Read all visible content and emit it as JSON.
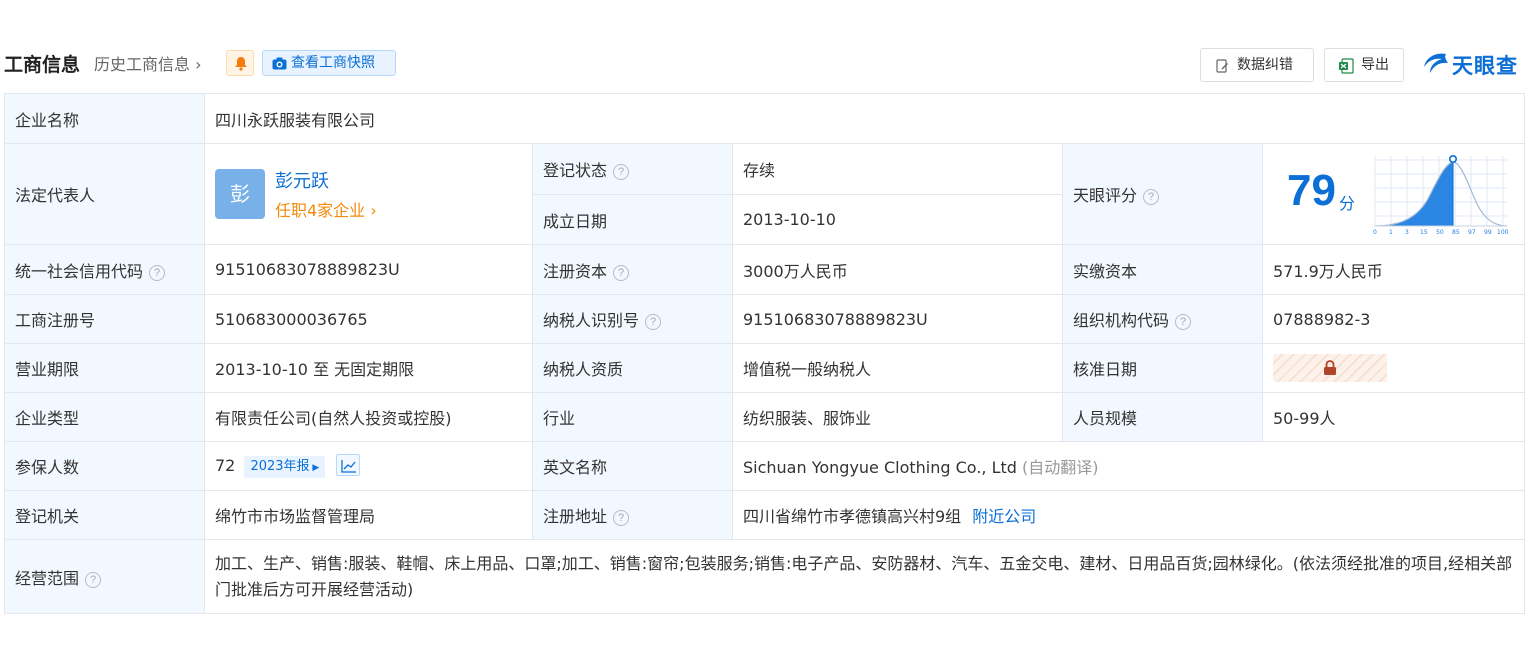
{
  "header": {
    "title": "工商信息",
    "history_link": "历史工商信息",
    "snapshot_button": "查看工商快照",
    "fix_button": "数据纠错",
    "export_button": "导出",
    "logo_text": "天眼查"
  },
  "company": {
    "name_label": "企业名称",
    "name": "四川永跃服装有限公司",
    "legal_rep_label": "法定代表人",
    "legal_rep_avatar": "彭",
    "legal_rep_name": "彭元跃",
    "legal_rep_roles": "任职4家企业",
    "reg_status_label": "登记状态",
    "reg_status": "存续",
    "found_date_label": "成立日期",
    "found_date": "2013-10-10",
    "score_label": "天眼评分",
    "score": "79",
    "score_unit": "分",
    "score_axis_labels": [
      "0",
      "1",
      "3",
      "15",
      "50",
      "85",
      "97",
      "99",
      "100"
    ],
    "credit_code_label": "统一社会信用代码",
    "credit_code": "91510683078889823U",
    "reg_capital_label": "注册资本",
    "reg_capital": "3000万人民币",
    "paid_capital_label": "实缴资本",
    "paid_capital": "571.9万人民币",
    "biz_reg_no_label": "工商注册号",
    "biz_reg_no": "510683000036765",
    "taxpayer_id_label": "纳税人识别号",
    "taxpayer_id": "91510683078889823U",
    "org_code_label": "组织机构代码",
    "org_code": "07888982-3",
    "term_label": "营业期限",
    "term": "2013-10-10 至 无固定期限",
    "taxpayer_qual_label": "纳税人资质",
    "taxpayer_qual": "增值税一般纳税人",
    "approval_date_label": "核准日期",
    "type_label": "企业类型",
    "type": "有限责任公司(自然人投资或控股)",
    "industry_label": "行业",
    "industry": "纺织服装、服饰业",
    "staff_size_label": "人员规模",
    "staff_size": "50-99人",
    "insured_label": "参保人数",
    "insured": "72",
    "insured_year_tag": "2023年报",
    "english_name_label": "英文名称",
    "english_name": "Sichuan Yongyue Clothing Co., Ltd",
    "english_name_note": "(自动翻译)",
    "authority_label": "登记机关",
    "authority": "绵竹市市场监督管理局",
    "address_label": "注册地址",
    "address": "四川省绵竹市孝德镇高兴村9组",
    "nearby_link": "附近公司",
    "scope_label": "经营范围",
    "scope": "加工、生产、销售:服装、鞋帽、床上用品、口罩;加工、销售:窗帘;包装服务;销售:电子产品、安防器材、汽车、五金交电、建材、日用品百货;园林绿化。(依法须经批准的项目,经相关部门批准后方可开展经营活动)"
  },
  "colors": {
    "accent": "#0b6fd6",
    "label_bg": "#f2f8ff",
    "status_green": "#19a054",
    "orange": "#f28b0c"
  }
}
